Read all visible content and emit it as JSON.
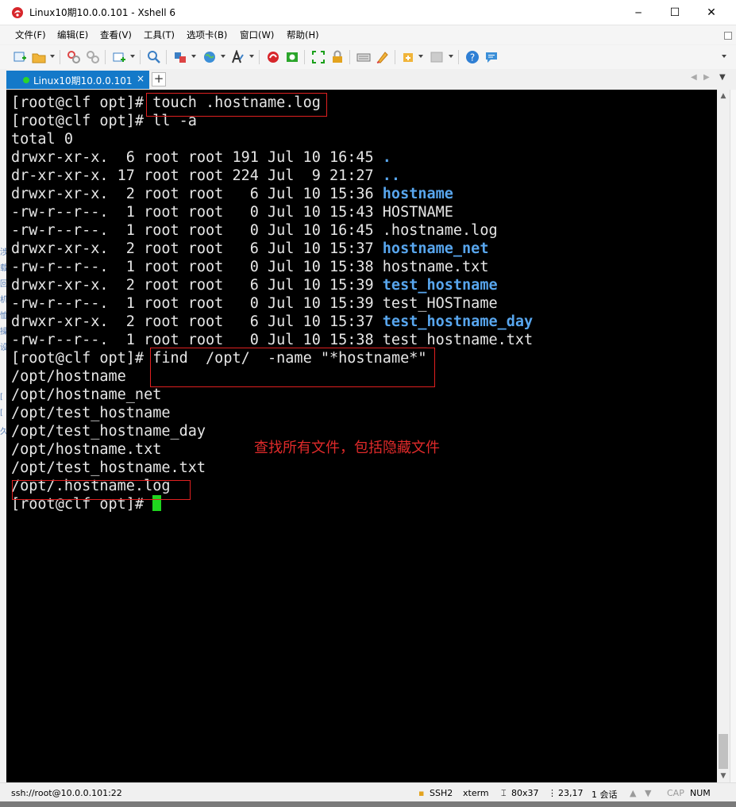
{
  "window": {
    "title": "Linux10期10.0.0.101 - Xshell 6",
    "minimize_glyph": "─",
    "maximize_glyph": "☐",
    "close_glyph": "✕"
  },
  "menu": [
    "文件(F)",
    "编辑(E)",
    "查看(V)",
    "工具(T)",
    "选项卡(B)",
    "窗口(W)",
    "帮助(H)"
  ],
  "toolbar_icons": [
    "new-session-icon",
    "open-folder-icon",
    "connect-icon",
    "disconnect-icon",
    "new-tab-icon",
    "find-icon",
    "transfer-icon",
    "globe-icon",
    "font-icon",
    "xftp-icon",
    "xmanager-icon",
    "fullscreen-icon",
    "lock-icon",
    "keyboard-icon",
    "highlight-icon",
    "add-icon",
    "layout-icon",
    "help-icon",
    "chat-icon"
  ],
  "tab": {
    "label": "Linux10期10.0.0.101",
    "close_glyph": "×",
    "add_glyph": "+"
  },
  "terminal": {
    "lines": [
      {
        "prompt": "[root@clf opt]# ",
        "cmd": "touch .hostname.log"
      },
      {
        "prompt": "[root@clf opt]# ",
        "cmd": "ll -a"
      },
      {
        "text": "total 0"
      },
      {
        "meta": "drwxr-xr-x.  6 root root 191 Jul 10 16:45 ",
        "name": ".",
        "dir": true
      },
      {
        "meta": "dr-xr-xr-x. 17 root root 224 Jul  9 21:27 ",
        "name": "..",
        "dir": true
      },
      {
        "meta": "drwxr-xr-x.  2 root root   6 Jul 10 15:36 ",
        "name": "hostname",
        "dir": true
      },
      {
        "meta": "-rw-r--r--.  1 root root   0 Jul 10 15:43 ",
        "name": "HOSTNAME",
        "dir": false
      },
      {
        "meta": "-rw-r--r--.  1 root root   0 Jul 10 16:45 ",
        "name": ".hostname.log",
        "dir": false
      },
      {
        "meta": "drwxr-xr-x.  2 root root   6 Jul 10 15:37 ",
        "name": "hostname_net",
        "dir": true
      },
      {
        "meta": "-rw-r--r--.  1 root root   0 Jul 10 15:38 ",
        "name": "hostname.txt",
        "dir": false
      },
      {
        "meta": "drwxr-xr-x.  2 root root   6 Jul 10 15:39 ",
        "name": "test_hostname",
        "dir": true
      },
      {
        "meta": "-rw-r--r--.  1 root root   0 Jul 10 15:39 ",
        "name": "test_HOSTname",
        "dir": false
      },
      {
        "meta": "drwxr-xr-x.  2 root root   6 Jul 10 15:37 ",
        "name": "test_hostname_day",
        "dir": true
      },
      {
        "meta": "-rw-r--r--.  1 root root   0 Jul 10 15:38 ",
        "name": "test_hostname.txt",
        "dir": false
      },
      {
        "prompt": "[root@clf opt]# ",
        "cmd": "find  /opt/  -name \"*hostname*\""
      },
      {
        "text": "/opt/hostname"
      },
      {
        "text": "/opt/hostname_net"
      },
      {
        "text": "/opt/test_hostname"
      },
      {
        "text": "/opt/test_hostname_day"
      },
      {
        "text": "/opt/hostname.txt"
      },
      {
        "text": "/opt/test_hostname.txt"
      },
      {
        "text": "/opt/.hostname.log"
      },
      {
        "prompt": "[root@clf opt]# ",
        "cursor": true
      }
    ],
    "annotation": "查找所有文件，包括隐藏文件",
    "colors": {
      "dir": "#58a6ee",
      "text": "#e6e6e6",
      "cursor": "#1fd51f",
      "highlight": "#e02020"
    }
  },
  "left_strip_glyphs": [
    "涉",
    "载",
    "回",
    "机",
    "恤",
    "操",
    "设",
    "[",
    "[",
    "久"
  ],
  "statusbar": {
    "connection": "ssh://root@10.0.0.101:22",
    "protocol": "SSH2",
    "terminal_type": "xterm",
    "size": "80x37",
    "position": "23,17",
    "sessions": "1 会话",
    "cap": "CAP",
    "num": "NUM"
  }
}
